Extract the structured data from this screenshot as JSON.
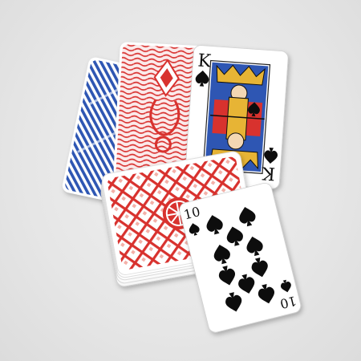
{
  "scene": {
    "description_colors": {
      "background": "#e8e8e8",
      "blue_back": "#2f57b3",
      "red_back": "#d8302f",
      "card_face": "#ffffff",
      "ink_black": "#111111",
      "gold": "#e7b436"
    }
  },
  "cards": {
    "king": {
      "rank": "K",
      "suit": "spade-icon"
    },
    "ten": {
      "rank": "10",
      "suit": "spade-icon"
    }
  }
}
